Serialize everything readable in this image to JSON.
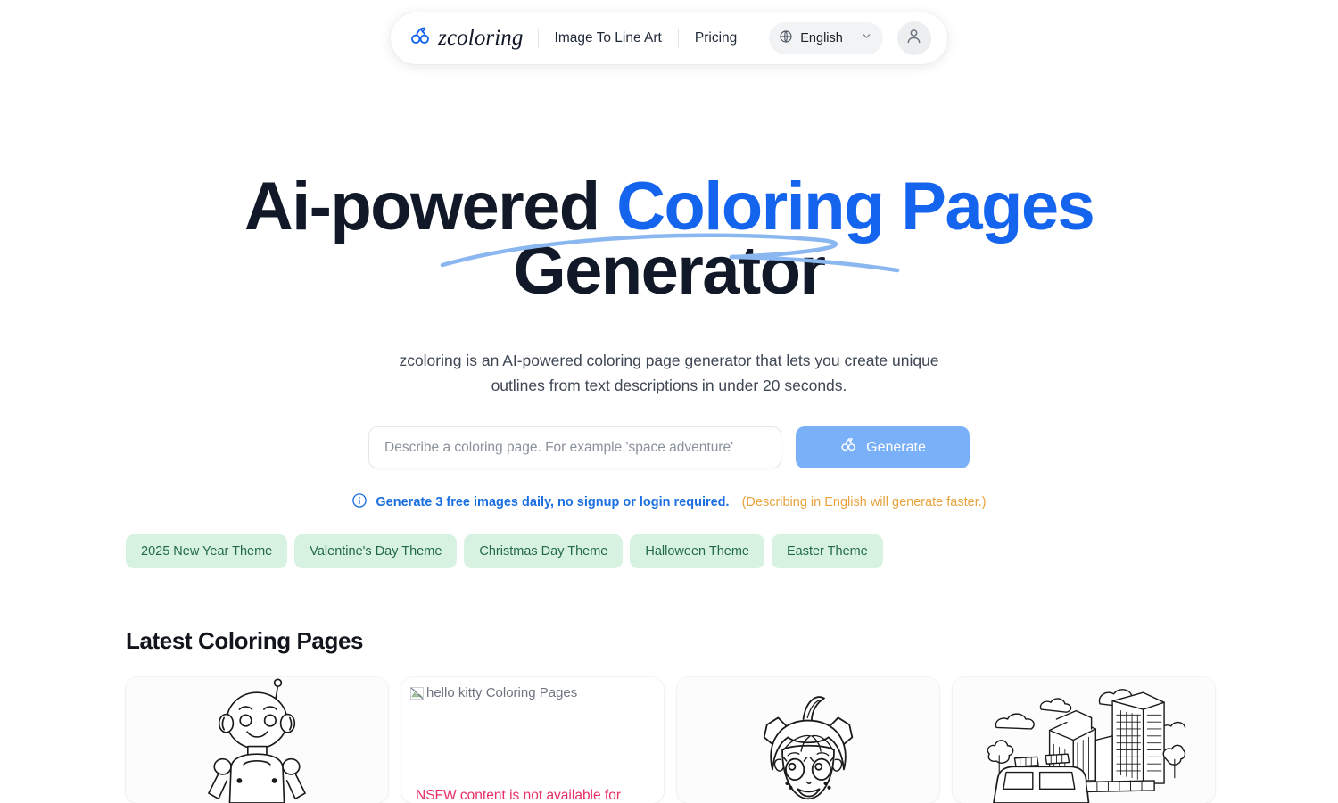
{
  "header": {
    "brand": {
      "name": "zcoloring",
      "logo_icon": "cherry-icon",
      "color": "#1464ee"
    },
    "nav": [
      {
        "label": "Image To Line Art"
      },
      {
        "label": "Pricing"
      }
    ],
    "language": {
      "icon": "globe-icon",
      "selected": "English",
      "chevron_icon": "chevron-down-icon"
    },
    "account": {
      "icon": "user-avatar-icon"
    }
  },
  "hero": {
    "headline_part1": "Ai-powered ",
    "headline_accent": "Coloring Pages",
    "headline_part2": "Generator",
    "accent_color": "#1464ee",
    "underline_color": "#8bb7f0",
    "subtitle": "zcoloring is an AI-powered coloring page generator that lets you create unique outlines from text descriptions in under 20 seconds."
  },
  "search": {
    "placeholder": "Describe a coloring page. For example,'space adventure'",
    "value": "",
    "generate_label": "Generate",
    "generate_icon": "cherry-icon",
    "generate_color": "#79b0f7"
  },
  "notice": {
    "icon": "info-circle-icon",
    "main": "Generate 3 free images daily, no signup or login required.",
    "main_color": "#1b6fe0",
    "sub": "(Describing in English will generate faster.)",
    "sub_color": "#e8a33d"
  },
  "themes": {
    "chip_bg": "#d7f2e1",
    "chip_text_color": "#22694a",
    "items": [
      {
        "label": "2025 New Year Theme"
      },
      {
        "label": "Valentine's Day Theme"
      },
      {
        "label": "Christmas Day Theme"
      },
      {
        "label": "Halloween Theme"
      },
      {
        "label": "Easter Theme"
      }
    ]
  },
  "latest": {
    "title": "Latest Coloring Pages",
    "cards": [
      {
        "name": "robot-coloring-page",
        "state": "loaded"
      },
      {
        "name": "hello-kitty-coloring-page",
        "state": "broken",
        "alt_text": "hello kitty Coloring Pages",
        "nsfw_message": "NSFW content is not available for",
        "nsfw_color": "#eb2f64"
      },
      {
        "name": "cute-girl-coloring-page",
        "state": "loaded"
      },
      {
        "name": "city-firetruck-coloring-page",
        "state": "loaded"
      }
    ]
  }
}
